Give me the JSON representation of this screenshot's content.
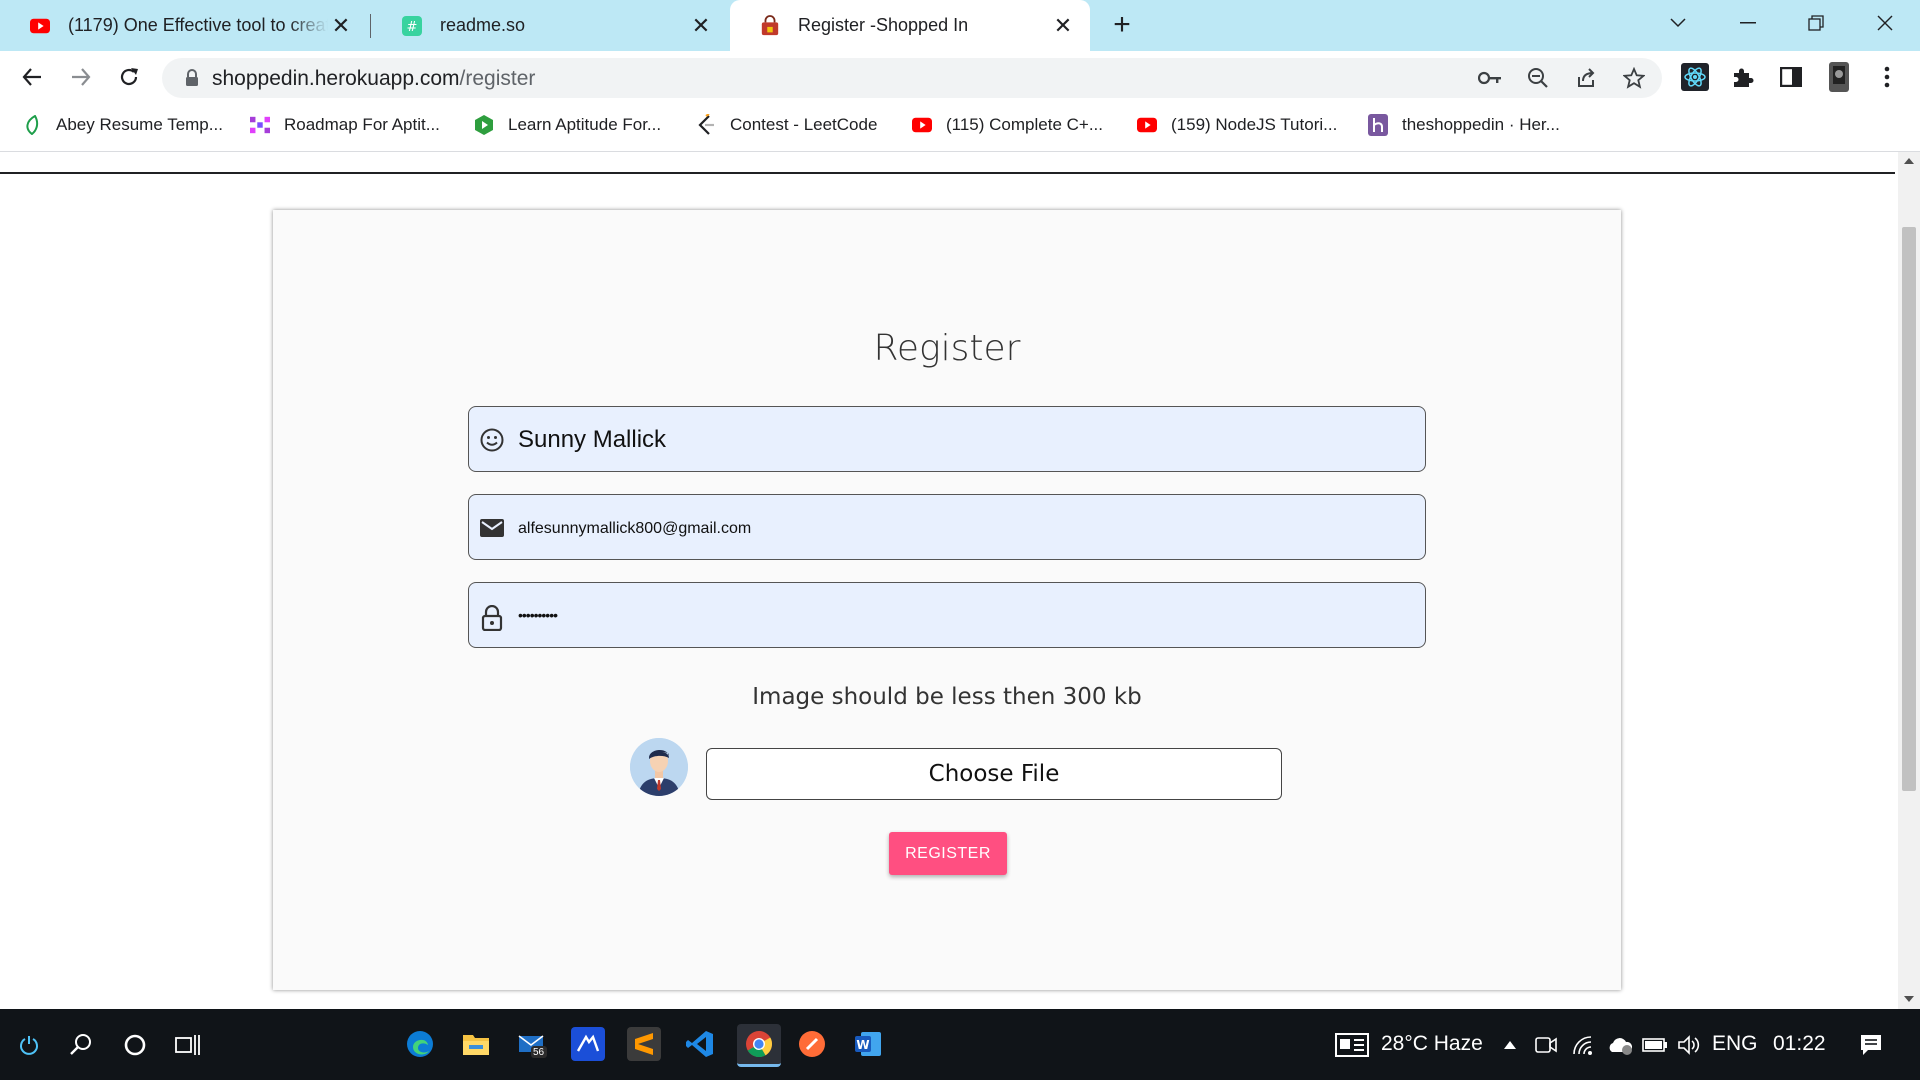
{
  "browser": {
    "tabs": [
      {
        "title": "(1179) One Effective tool to creat",
        "icon": "youtube-icon",
        "active": false
      },
      {
        "title": "readme.so",
        "icon": "readme-icon",
        "active": false
      },
      {
        "title": "Register -Shopped In",
        "icon": "shopping-bag-icon",
        "active": true
      }
    ],
    "new_tab": "+",
    "address": {
      "host": "shoppedin.herokuapp.com",
      "path": "/register"
    },
    "bookmarks": [
      {
        "label": "Abey Resume Temp...",
        "icon": "leaf-icon"
      },
      {
        "label": "Roadmap For Aptit...",
        "icon": "roadmap-icon"
      },
      {
        "label": "Learn Aptitude For...",
        "icon": "shield-icon"
      },
      {
        "label": "Contest - LeetCode",
        "icon": "leetcode-icon"
      },
      {
        "label": "(115) Complete C+...",
        "icon": "youtube-icon"
      },
      {
        "label": "(159) NodeJS Tutori...",
        "icon": "youtube-icon"
      },
      {
        "label": "theshoppedin · Her...",
        "icon": "heroku-icon"
      }
    ]
  },
  "form": {
    "title": "Register",
    "name_value": "Sunny Mallick",
    "email_value": "alfesunnymallick800@gmail.com",
    "password_value": "••••••••••",
    "hint": "Image should be less then 300 kb",
    "choose_file_label": "Choose File",
    "register_label": "REGISTER"
  },
  "taskbar": {
    "weather": "28°C  Haze",
    "language": "ENG",
    "time": "01:22",
    "mail_badge": "56"
  },
  "colors": {
    "tabstrip": "#bde8f5",
    "field_bg": "#e8f0fe",
    "register_button": "#ff4f81"
  }
}
